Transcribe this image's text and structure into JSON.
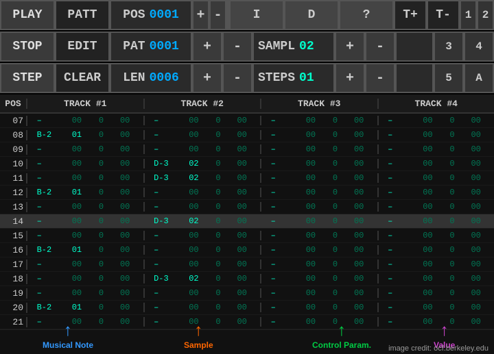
{
  "controls": {
    "row1": {
      "play_label": "PLAY",
      "patt_label": "PATT",
      "pos_label": "POS",
      "pos_value": "0001",
      "plus": "+",
      "minus": "-",
      "btn_i": "I",
      "btn_d": "D",
      "btn_q": "?",
      "btn_tplus": "T+",
      "btn_tminus": "T-",
      "btn_1": "1",
      "btn_2": "2"
    },
    "row2": {
      "stop_label": "STOP",
      "edit_label": "EDIT",
      "pat_label": "PAT",
      "pat_value": "0001",
      "plus": "+",
      "minus": "-",
      "sampl_label": "SAMPL",
      "sampl_value": "02",
      "plus2": "+",
      "minus2": "-",
      "btn_3": "3",
      "btn_4": "4"
    },
    "row3": {
      "step_label": "STEP",
      "clear_label": "CLEAR",
      "len_label": "LEN",
      "len_value": "0006",
      "plus": "+",
      "minus": "-",
      "steps_label": "STEPS",
      "steps_value": "01",
      "plus2": "+",
      "minus2": "-",
      "btn_5": "5",
      "btn_a": "A"
    }
  },
  "sequencer": {
    "header": {
      "pos": "POS",
      "track1": "TRACK #1",
      "track2": "TRACK #2",
      "track3": "TRACK #3",
      "track4": "TRACK #4"
    },
    "rows": [
      {
        "pos": "07",
        "t1": [
          "–",
          "00",
          "0",
          "00"
        ],
        "t2": [
          "–",
          "00",
          "0",
          "00"
        ],
        "t3": [
          "–",
          "00",
          "0",
          "00"
        ],
        "t4": [
          "–",
          "00",
          "0",
          "00"
        ],
        "highlight": false
      },
      {
        "pos": "08",
        "t1": [
          "B-2",
          "01",
          "0",
          "00"
        ],
        "t2": [
          "–",
          "00",
          "0",
          "00"
        ],
        "t3": [
          "–",
          "00",
          "0",
          "00"
        ],
        "t4": [
          "–",
          "00",
          "0",
          "00"
        ],
        "highlight": false
      },
      {
        "pos": "09",
        "t1": [
          "–",
          "00",
          "0",
          "00"
        ],
        "t2": [
          "–",
          "00",
          "0",
          "00"
        ],
        "t3": [
          "–",
          "00",
          "0",
          "00"
        ],
        "t4": [
          "–",
          "00",
          "0",
          "00"
        ],
        "highlight": false
      },
      {
        "pos": "10",
        "t1": [
          "–",
          "00",
          "0",
          "00"
        ],
        "t2": [
          "D-3",
          "02",
          "0",
          "00"
        ],
        "t3": [
          "–",
          "00",
          "0",
          "00"
        ],
        "t4": [
          "–",
          "00",
          "0",
          "00"
        ],
        "highlight": false
      },
      {
        "pos": "11",
        "t1": [
          "–",
          "00",
          "0",
          "00"
        ],
        "t2": [
          "D-3",
          "02",
          "0",
          "00"
        ],
        "t3": [
          "–",
          "00",
          "0",
          "00"
        ],
        "t4": [
          "–",
          "00",
          "0",
          "00"
        ],
        "highlight": false
      },
      {
        "pos": "12",
        "t1": [
          "B-2",
          "01",
          "0",
          "00"
        ],
        "t2": [
          "–",
          "00",
          "0",
          "00"
        ],
        "t3": [
          "–",
          "00",
          "0",
          "00"
        ],
        "t4": [
          "–",
          "00",
          "0",
          "00"
        ],
        "highlight": false
      },
      {
        "pos": "13",
        "t1": [
          "–",
          "00",
          "0",
          "00"
        ],
        "t2": [
          "–",
          "00",
          "0",
          "00"
        ],
        "t3": [
          "–",
          "00",
          "0",
          "00"
        ],
        "t4": [
          "–",
          "00",
          "0",
          "00"
        ],
        "highlight": false
      },
      {
        "pos": "14",
        "t1": [
          "–",
          "00",
          "0",
          "00"
        ],
        "t2": [
          "D-3",
          "02",
          "0",
          "00"
        ],
        "t3": [
          "–",
          "00",
          "0",
          "00"
        ],
        "t4": [
          "–",
          "00",
          "0",
          "00"
        ],
        "highlight": true
      },
      {
        "pos": "15",
        "t1": [
          "–",
          "00",
          "0",
          "00"
        ],
        "t2": [
          "–",
          "00",
          "0",
          "00"
        ],
        "t3": [
          "–",
          "00",
          "0",
          "00"
        ],
        "t4": [
          "–",
          "00",
          "0",
          "00"
        ],
        "highlight": false
      },
      {
        "pos": "16",
        "t1": [
          "B-2",
          "01",
          "0",
          "00"
        ],
        "t2": [
          "–",
          "00",
          "0",
          "00"
        ],
        "t3": [
          "–",
          "00",
          "0",
          "00"
        ],
        "t4": [
          "–",
          "00",
          "0",
          "00"
        ],
        "highlight": false
      },
      {
        "pos": "17",
        "t1": [
          "–",
          "00",
          "0",
          "00"
        ],
        "t2": [
          "–",
          "00",
          "0",
          "00"
        ],
        "t3": [
          "–",
          "00",
          "0",
          "00"
        ],
        "t4": [
          "–",
          "00",
          "0",
          "00"
        ],
        "highlight": false
      },
      {
        "pos": "18",
        "t1": [
          "–",
          "00",
          "0",
          "00"
        ],
        "t2": [
          "D-3",
          "02",
          "0",
          "00"
        ],
        "t3": [
          "–",
          "00",
          "0",
          "00"
        ],
        "t4": [
          "–",
          "00",
          "0",
          "00"
        ],
        "highlight": false
      },
      {
        "pos": "19",
        "t1": [
          "–",
          "00",
          "0",
          "00"
        ],
        "t2": [
          "–",
          "00",
          "0",
          "00"
        ],
        "t3": [
          "–",
          "00",
          "0",
          "00"
        ],
        "t4": [
          "–",
          "00",
          "0",
          "00"
        ],
        "highlight": false
      },
      {
        "pos": "20",
        "t1": [
          "B-2",
          "01",
          "0",
          "00"
        ],
        "t2": [
          "–",
          "00",
          "0",
          "00"
        ],
        "t3": [
          "–",
          "00",
          "0",
          "00"
        ],
        "t4": [
          "–",
          "00",
          "0",
          "00"
        ],
        "highlight": false
      },
      {
        "pos": "21",
        "t1": [
          "–",
          "00",
          "0",
          "00"
        ],
        "t2": [
          "–",
          "00",
          "0",
          "00"
        ],
        "t3": [
          "–",
          "00",
          "0",
          "00"
        ],
        "t4": [
          "–",
          "00",
          "0",
          "00"
        ],
        "highlight": false
      }
    ]
  },
  "annotations": [
    {
      "label": "Musical  Note",
      "color": "#3399ff",
      "left": "72"
    },
    {
      "label": "Sample",
      "color": "#ff6600",
      "left": "280"
    },
    {
      "label": "Control Param.",
      "color": "#00cc44",
      "left": "470"
    },
    {
      "label": "Value",
      "color": "#cc44cc",
      "left": "650"
    }
  ],
  "credit": "image credit: ocf.berkeley.edu"
}
